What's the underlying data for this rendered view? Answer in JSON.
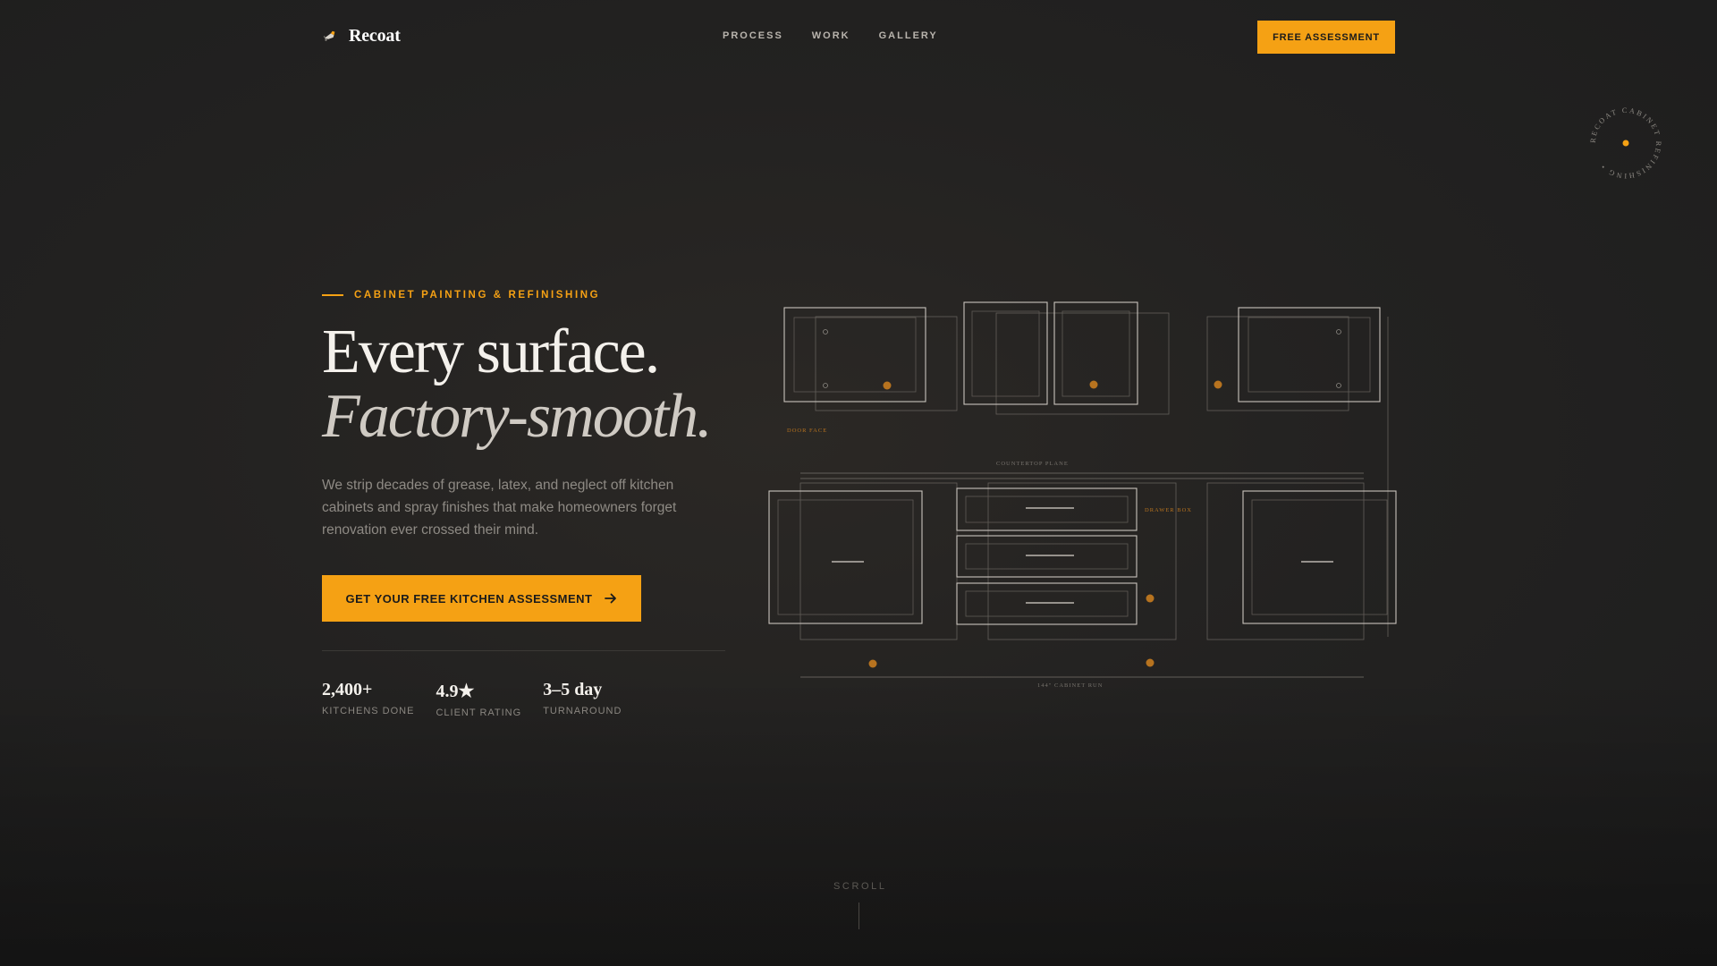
{
  "brand": {
    "name": "Recoat"
  },
  "nav": {
    "links": [
      "PROCESS",
      "WORK",
      "GALLERY"
    ],
    "cta": "FREE ASSESSMENT"
  },
  "badge": {
    "circular_text": "RECOAT CABINET REFINISHING •"
  },
  "hero": {
    "eyebrow": "CABINET PAINTING & REFINISHING",
    "headline_line1": "Every surface.",
    "headline_line2": "Factory-smooth.",
    "description": "We strip decades of grease, latex, and neglect off kitchen cabinets and spray finishes that make homeowners forget renovation ever crossed their mind.",
    "cta": "GET YOUR FREE KITCHEN ASSESSMENT"
  },
  "stats": [
    {
      "value": "2,400+",
      "label": "KITCHENS DONE"
    },
    {
      "value": "4.9★",
      "label": "CLIENT RATING"
    },
    {
      "value": "3–5 day",
      "label": "TURNAROUND"
    }
  ],
  "diagram": {
    "labels": {
      "door_face": "DOOR FACE",
      "countertop_plane": "COUNTERTOP PLANE",
      "drawer_box": "DRAWER BOX",
      "cabinet_run": "144\" CABINET RUN"
    }
  },
  "scroll": {
    "label": "SCROLL"
  },
  "colors": {
    "accent": "#f5a114",
    "background": "#232221",
    "text": "#f4f1ec",
    "muted": "#8e8a84"
  },
  "icons": {
    "logo": "spray-gun-icon",
    "cta_arrow": "arrow-right-icon"
  }
}
